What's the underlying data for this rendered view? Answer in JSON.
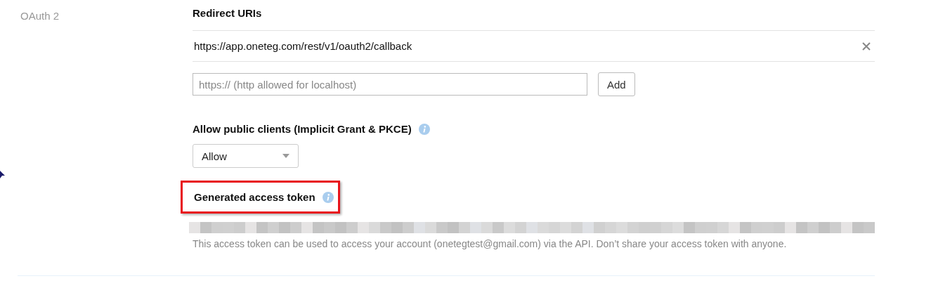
{
  "section_label": "OAuth 2",
  "redirect_uris": {
    "heading": "Redirect URIs",
    "uris": [
      {
        "value": "https://app.oneteg.com/rest/v1/oauth2/callback"
      }
    ],
    "new_uri": {
      "placeholder": "https:// (http allowed for localhost)"
    },
    "add_button": "Add"
  },
  "public_clients": {
    "heading": "Allow public clients (Implicit Grant & PKCE)",
    "select": {
      "value": "Allow"
    }
  },
  "access_token": {
    "heading": "Generated access token",
    "highlighted": true,
    "help": "This access token can be used to access your account (onetegtest@gmail.com) via the API. Don’t share your access token with anyone."
  }
}
